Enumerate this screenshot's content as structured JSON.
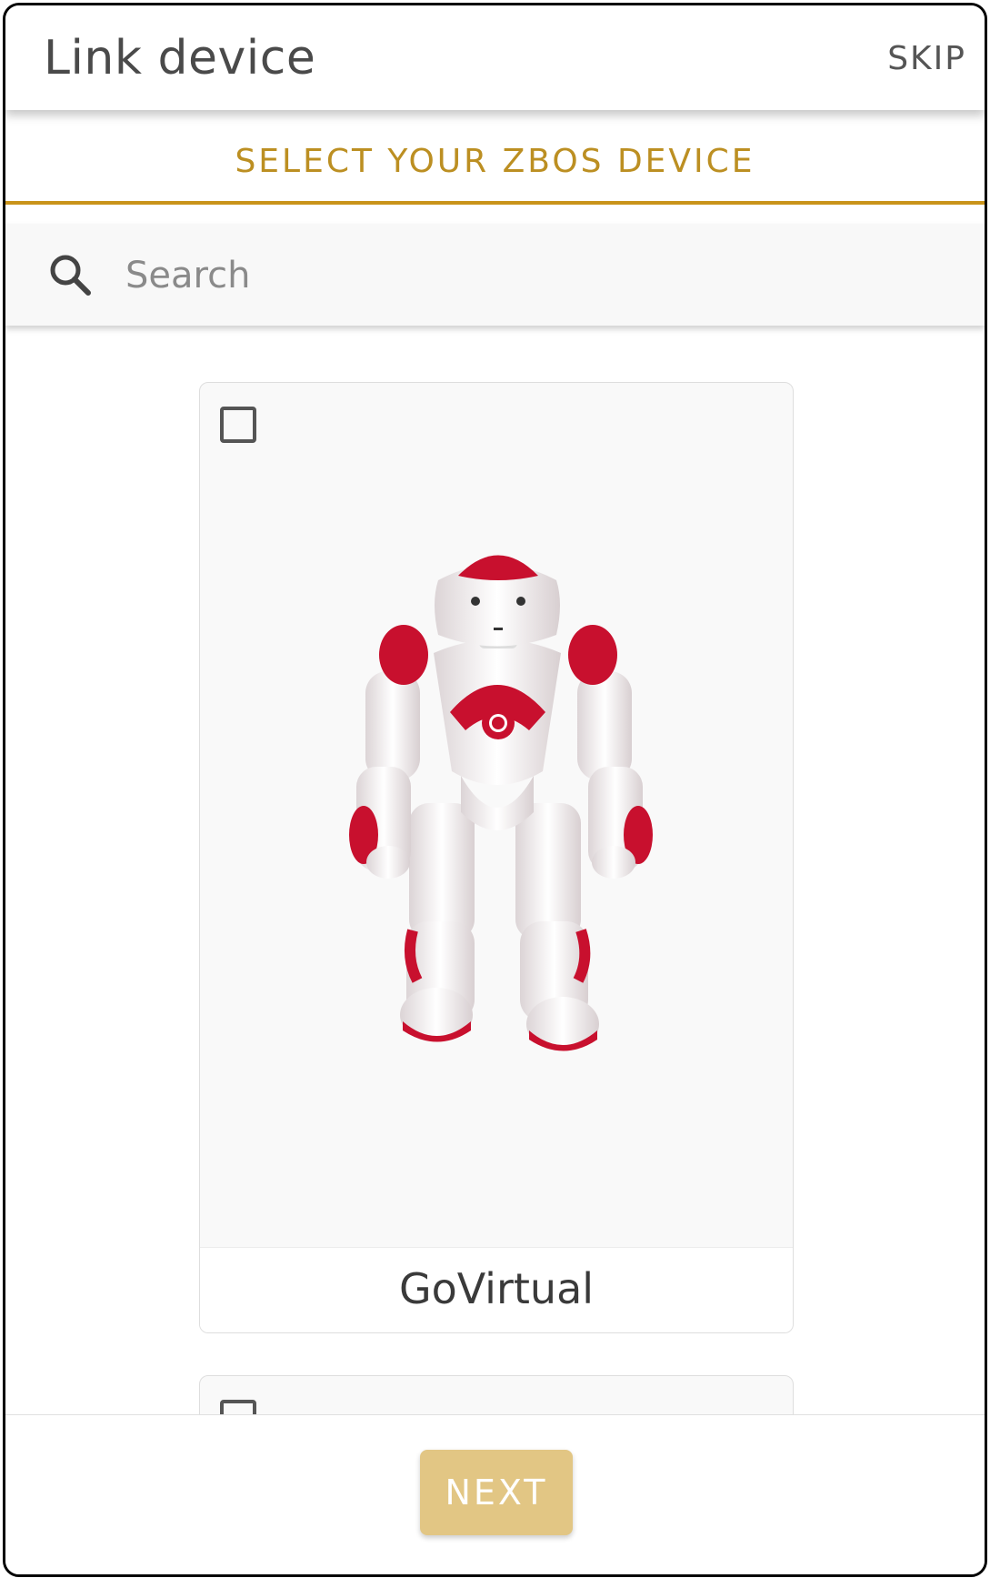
{
  "header": {
    "title": "Link device",
    "skip_label": "SKIP"
  },
  "tabs": [
    {
      "label": "SELECT YOUR ZBOS DEVICE",
      "active": true
    }
  ],
  "search": {
    "placeholder": "Search",
    "value": ""
  },
  "devices": [
    {
      "name": "GoVirtual",
      "checked": false,
      "image": "robot-image"
    },
    {
      "name": "",
      "checked": false
    }
  ],
  "footer": {
    "next_label": "NEXT"
  },
  "colors": {
    "accent": "#c9931a",
    "next_button": "#e2c684",
    "robot_red": "#c8102e"
  }
}
